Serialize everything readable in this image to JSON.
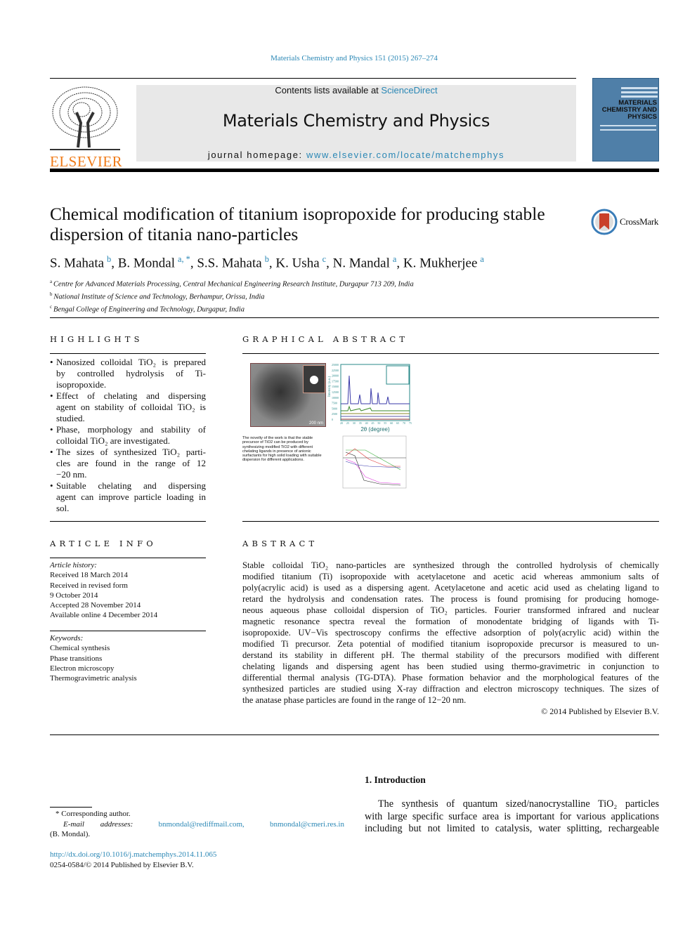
{
  "header": {
    "journal_ref": "Materials Chemistry and Physics 151 (2015) 267–274",
    "contents_prefix": "Contents lists available at ",
    "contents_link": "ScienceDirect",
    "journal_title": "Materials Chemistry and Physics",
    "homepage_prefix": "journal homepage: ",
    "homepage_link": "www.elsevier.com/locate/matchemphys",
    "publisher_logo": "ELSEVIER",
    "cover_title": "MATERIALS CHEMISTRY AND PHYSICS"
  },
  "article": {
    "title_line1": "Chemical modification of titanium isopropoxide for producing stable",
    "title_line2": "dispersion of titania nano-particles",
    "crossmark": "CrossMark",
    "authors": [
      {
        "name": "S. Mahata",
        "sup": "b"
      },
      {
        "name": "B. Mondal",
        "sup": "a, *"
      },
      {
        "name": "S.S. Mahata",
        "sup": "b"
      },
      {
        "name": "K. Usha",
        "sup": "c"
      },
      {
        "name": "N. Mandal",
        "sup": "a"
      },
      {
        "name": "K. Mukherjee",
        "sup": "a"
      }
    ],
    "affiliations": [
      {
        "key": "a",
        "text": "Centre for Advanced Materials Processing, Central Mechanical Engineering Research Institute, Durgapur 713 209, India"
      },
      {
        "key": "b",
        "text": "National Institute of Science and Technology, Berhampur, Orissa, India"
      },
      {
        "key": "c",
        "text": "Bengal College of Engineering and Technology, Durgapur, India"
      }
    ]
  },
  "highlights": {
    "heading": "HIGHLIGHTS",
    "lines": [
      {
        "b": true,
        "t": "Nanosized colloidal TiO₂ is prepared"
      },
      {
        "t": "by controlled hydrolysis of Ti-"
      },
      {
        "t": "isopropoxide.",
        "last": true
      },
      {
        "b": true,
        "t": "Effect of chelating and dispersing"
      },
      {
        "t": "agent on stability of colloidal TiO₂ is"
      },
      {
        "t": "studied.",
        "last": true
      },
      {
        "b": true,
        "t": "Phase, morphology and stability of"
      },
      {
        "t": "colloidal TiO₂ are investigated.",
        "last": true
      },
      {
        "b": true,
        "t": "The sizes of synthesized TiO₂ parti-"
      },
      {
        "t": "cles are found in the range of 12"
      },
      {
        "t": "−20 nm.",
        "last": true
      },
      {
        "b": true,
        "t": "Suitable chelating and dispersing"
      },
      {
        "t": "agent can improve particle loading in"
      },
      {
        "t": "sol.",
        "last": true
      }
    ]
  },
  "graphical_abstract": {
    "heading": "GRAPHICAL ABSTRACT",
    "caption": "The novelty of the work is that the stable precursor of TiO2 can be produced by synthesizing modified TiO2 with different chelating ligands in presence of anionic surfactants for high solid loading with suitable dispersion for different applications.",
    "tem_scale": "200 nm",
    "xrd_ylabel": "Intensity (a.u.)",
    "xrd_xlabel": "2θ (degree)",
    "xrd_yticks": [
      "25000",
      "22500",
      "20000",
      "17500",
      "15000",
      "12500",
      "10000",
      "7500",
      "5000",
      "2500",
      "0"
    ],
    "xrd_xticks": [
      "20",
      "25",
      "30",
      "35",
      "40",
      "45",
      "50",
      "55",
      "60",
      "65",
      "70",
      "75"
    ]
  },
  "article_info": {
    "heading": "ARTICLE INFO",
    "history_label": "Article history:",
    "history": [
      "Received 18 March 2014",
      "Received in revised form",
      "9 October 2014",
      "Accepted 28 November 2014",
      "Available online 4 December 2014"
    ],
    "keywords_label": "Keywords:",
    "keywords": [
      "Chemical synthesis",
      "Phase transitions",
      "Electron microscopy",
      "Thermogravimetric analysis"
    ]
  },
  "abstract": {
    "heading": "ABSTRACT",
    "lines": [
      "Stable colloidal TiO₂ nano-particles are synthesized through the controlled hydrolysis of chemically",
      "modified titanium (Ti) isopropoxide with acetylacetone and acetic acid whereas ammonium salts of",
      "poly(acrylic acid) is used as a dispersing agent. Acetylacetone and acetic acid used as chelating ligand to",
      "retard the hydrolysis and condensation rates. The process is found promising for producing homoge-",
      "neous aqueous phase colloidal dispersion of TiO₂ particles. Fourier transformed infrared and nuclear",
      "magnetic resonance spectra reveal the formation of monodentate bridging of ligands with Ti-",
      "isopropoxide. UV−Vis spectroscopy confirms the effective adsorption of poly(acrylic acid) within the",
      "modified Ti precursor. Zeta potential of modified titanium isopropoxide precursor is measured to un-",
      "derstand its stability in different pH. The thermal stability of the precursors modified with different",
      "chelating ligands and dispersing agent has been studied using thermo-gravimetric in conjunction to",
      "differential thermal analysis (TG-DTA). Phase formation behavior and the morphological features of the",
      "synthesized particles are studied using X-ray diffraction and electron microscopy techniques. The sizes of",
      "the anatase phase particles are found in the range of 12−20 nm."
    ],
    "copyright": "© 2014 Published by Elsevier B.V."
  },
  "introduction": {
    "heading": "1.  Introduction",
    "lines": [
      "The synthesis of quantum sized/nanocrystalline TiO₂ particles",
      "with large specific surface area is important for various applications",
      "including but not limited to catalysis, water splitting, rechargeable"
    ]
  },
  "footnote": {
    "marker": "*",
    "corresponding": "Corresponding author.",
    "email_label": "E-mail addresses:",
    "email1": "bnmondal@rediffmail.com,",
    "email2": "bnmondal@cmeri.res.in",
    "name": "(B. Mondal).",
    "doi": "http://dx.doi.org/10.1016/j.matchemphys.2014.11.065",
    "issn": "0254-0584/© 2014 Published by Elsevier B.V."
  },
  "colors": {
    "link": "#2a87b5",
    "elsevier": "#f07c1a",
    "cover": "#4f7fa8",
    "banner": "#e8e8e8"
  }
}
